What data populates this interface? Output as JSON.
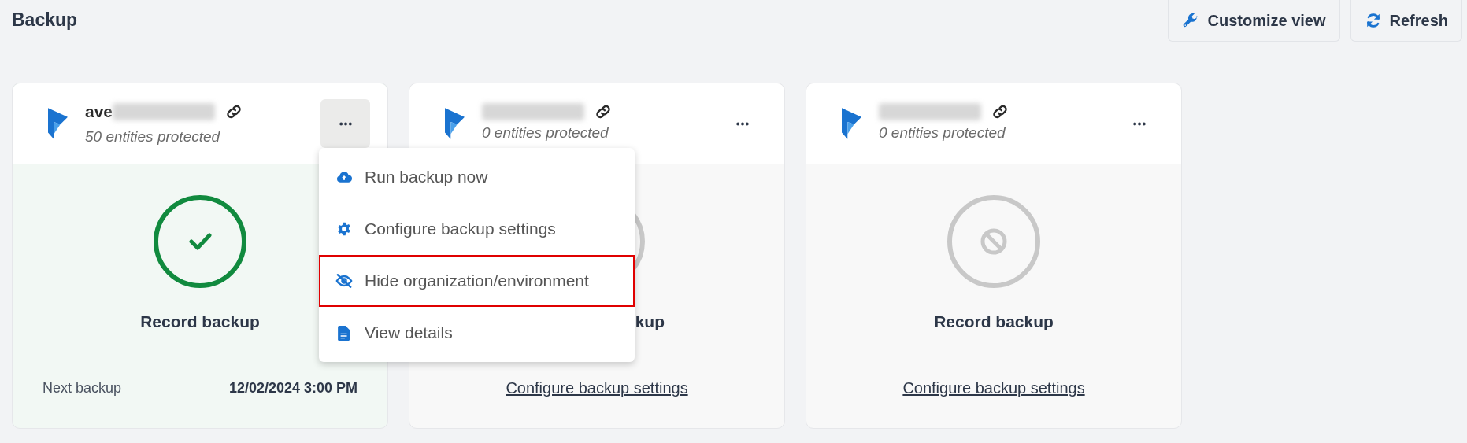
{
  "page_title": "Backup",
  "toolbar": [
    {
      "kind": "customize",
      "label": "Customize view"
    },
    {
      "kind": "refresh",
      "label": "Refresh"
    }
  ],
  "cards": [
    {
      "name": "ave",
      "name_redacted": true,
      "subtitle": "50 entities protected",
      "menu_open": true,
      "kind": "success",
      "title": "Record backup",
      "covered": false,
      "footer": {
        "kind": "schedule",
        "label": "Next backup",
        "value": "12/02/2024 3:00 PM"
      }
    },
    {
      "name_redacted": true,
      "subtitle": "0 entities protected",
      "menu_open": false,
      "kind": "disabled",
      "title": "kup",
      "covered": true,
      "footer": {
        "kind": "link",
        "label": "Configure backup settings"
      }
    },
    {
      "name_redacted": true,
      "subtitle": "0 entities protected",
      "menu_open": false,
      "kind": "disabled",
      "title": "Record backup",
      "covered": false,
      "footer": {
        "kind": "link",
        "label": "Configure backup settings"
      }
    }
  ],
  "menu": {
    "items": [
      {
        "kind": "upload",
        "label": "Run backup now",
        "highlighted": false
      },
      {
        "kind": "gear",
        "label": "Configure backup settings",
        "highlighted": false
      },
      {
        "kind": "hide",
        "label": "Hide organization/environment",
        "highlighted": true
      },
      {
        "kind": "document",
        "label": "View details",
        "highlighted": false
      }
    ]
  }
}
